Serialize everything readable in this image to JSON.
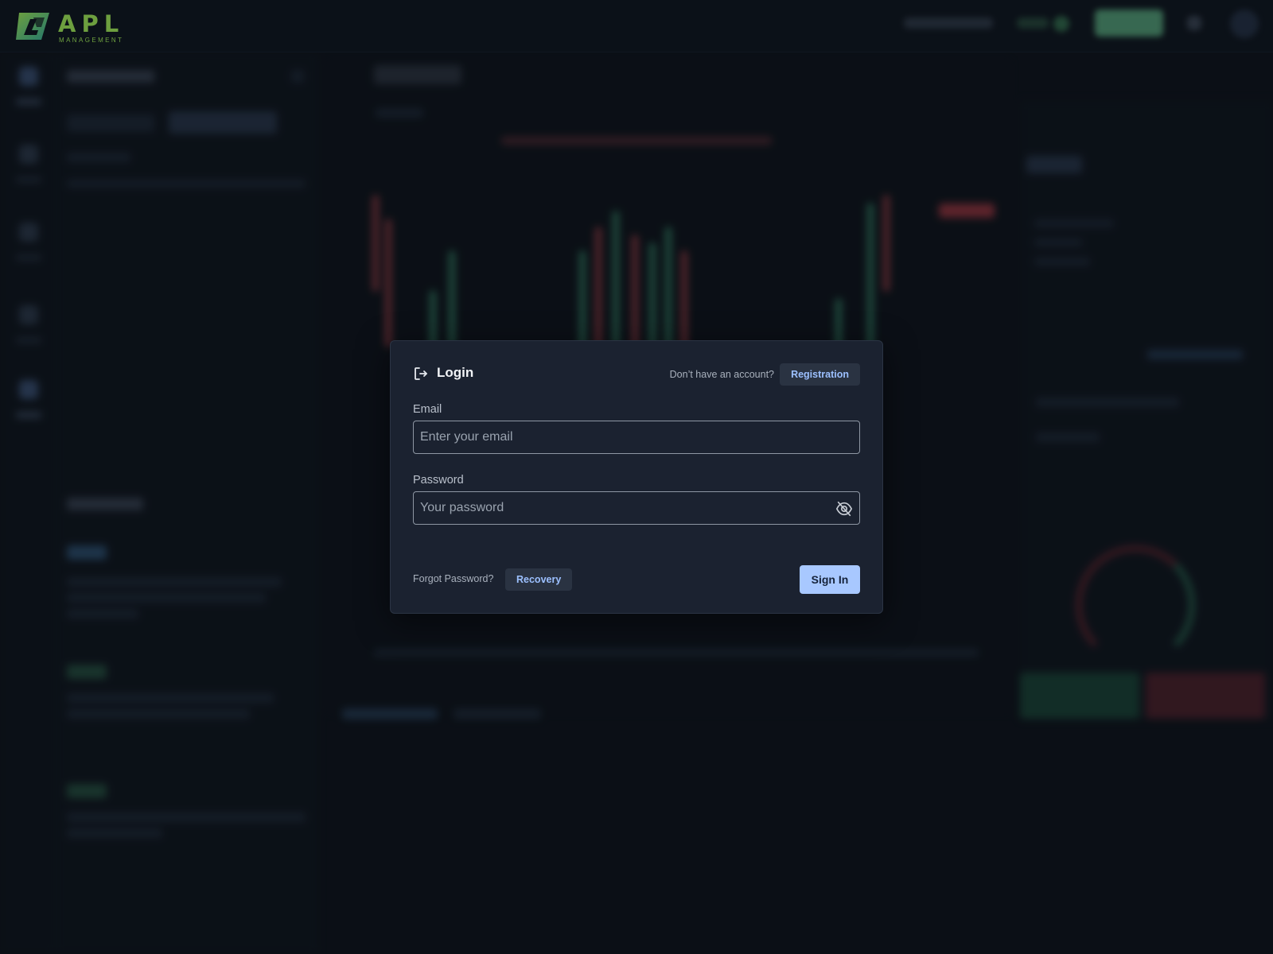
{
  "brand": {
    "name": "APL",
    "tagline": "MANAGEMENT",
    "accent_color": "#8fd14f"
  },
  "modal": {
    "title": "Login",
    "title_icon": "login-arrow-icon",
    "no_account_text": "Don’t have an account?",
    "registration_label": "Registration",
    "email": {
      "label": "Email",
      "placeholder": "Enter your email",
      "value": ""
    },
    "password": {
      "label": "Password",
      "placeholder": "Your password",
      "value": "",
      "toggle_icon": "eye-off-icon"
    },
    "forgot_text": "Forgot Password?",
    "recovery_label": "Recovery",
    "signin_label": "Sign In",
    "colors": {
      "background": "#1b2230",
      "primary_button": "#a8c8ff",
      "link_text": "#9cc0ff"
    }
  }
}
